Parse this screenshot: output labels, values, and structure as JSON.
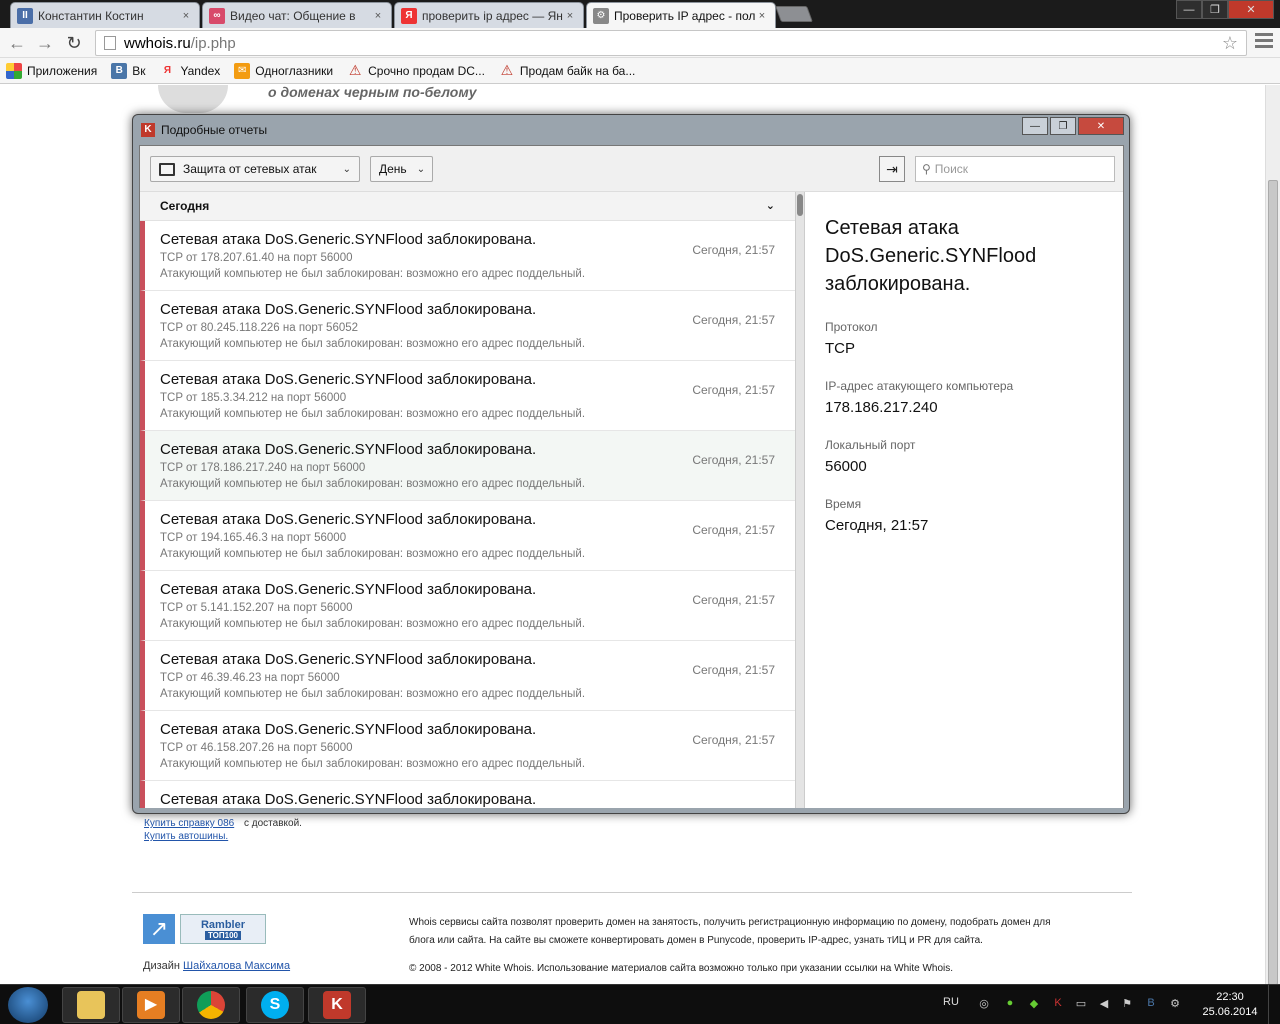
{
  "browser": {
    "tabs": [
      {
        "title": "Константин Костин",
        "favicon_color": "#4a6ea8",
        "favicon_glyph": "II"
      },
      {
        "title": "Видео чат: Общение в",
        "favicon_color": "#d84a6a",
        "favicon_glyph": "∞"
      },
      {
        "title": "проверить ip адрес — Ян",
        "favicon_color": "#e33",
        "favicon_glyph": "Я"
      },
      {
        "title": "Проверить IP адрес - пол",
        "favicon_color": "#888",
        "favicon_glyph": "⚙"
      }
    ],
    "tab_close": "×",
    "window_controls": {
      "minimize": "—",
      "maximize": "❐",
      "close": "✕"
    },
    "nav": {
      "back": "←",
      "forward": "→",
      "reload": "↻"
    },
    "url_host": "wwhois.ru",
    "url_path": "/ip.php",
    "star": "☆",
    "bookmarks": [
      {
        "label": "Приложения",
        "icon": "apps-icon",
        "color": "#e44"
      },
      {
        "label": "Вк",
        "icon": "vk-icon",
        "color": "#4a76a8",
        "glyph": "В"
      },
      {
        "label": "Yandex",
        "icon": "yandex-icon",
        "color": "#fff",
        "glyph": "Я"
      },
      {
        "label": "Одноглазники",
        "icon": "mail-icon",
        "color": "#f39c12",
        "glyph": "✉"
      },
      {
        "label": "Срочно продам DC...",
        "icon": "warning-icon",
        "color": "#fff",
        "glyph": "⚠"
      },
      {
        "label": "Продам байк на ба...",
        "icon": "warning-icon",
        "color": "#fff",
        "glyph": "⚠"
      }
    ]
  },
  "page": {
    "tagline": "о доменах черным по-белому",
    "link_buy_086": "Купить справку 086",
    "text_delivery": "с доставкой.",
    "link_tires": "Купить автошины.",
    "rambler_title": "Rambler",
    "rambler_sub": "ТОП100",
    "design_prefix": "Дизайн",
    "design_link": "Шайхалова Максима",
    "footer_line1": "Whois сервисы сайта позволят проверить домен на занятость, получить регистрационную информацию по домену, подобрать домен для",
    "footer_line2": "блога или сайта. На сайте вы сможете конвертировать домен в Punycode, проверить IP-адрес, узнать тИЦ и PR для сайта.",
    "footer_copyright": "© 2008 - 2012 White Whois. Использование материалов сайта возможно только при указании ссылки на White Whois."
  },
  "kaspersky": {
    "window_title": "Подробные отчеты",
    "filter_category": "Защита от сетевых атак",
    "filter_period": "День",
    "search_placeholder": "Поиск",
    "group_label": "Сегодня",
    "rows": [
      {
        "title": "Сетевая атака DoS.Generic.SYNFlood заблокирована.",
        "sub": "TCP от 178.207.61.40 на порт 56000",
        "note": "Атакующий компьютер не был заблокирован: возможно его адрес поддельный.",
        "time": "Сегодня, 21:57",
        "selected": false
      },
      {
        "title": "Сетевая атака DoS.Generic.SYNFlood заблокирована.",
        "sub": "TCP от 80.245.118.226 на порт 56052",
        "note": "Атакующий компьютер не был заблокирован: возможно его адрес поддельный.",
        "time": "Сегодня, 21:57",
        "selected": false
      },
      {
        "title": "Сетевая атака DoS.Generic.SYNFlood заблокирована.",
        "sub": "TCP от 185.3.34.212 на порт 56000",
        "note": "Атакующий компьютер не был заблокирован: возможно его адрес поддельный.",
        "time": "Сегодня, 21:57",
        "selected": false
      },
      {
        "title": "Сетевая атака DoS.Generic.SYNFlood заблокирована.",
        "sub": "TCP от 178.186.217.240 на порт 56000",
        "note": "Атакующий компьютер не был заблокирован: возможно его адрес поддельный.",
        "time": "Сегодня, 21:57",
        "selected": true
      },
      {
        "title": "Сетевая атака DoS.Generic.SYNFlood заблокирована.",
        "sub": "TCP от 194.165.46.3 на порт 56000",
        "note": "Атакующий компьютер не был заблокирован: возможно его адрес поддельный.",
        "time": "Сегодня, 21:57",
        "selected": false
      },
      {
        "title": "Сетевая атака DoS.Generic.SYNFlood заблокирована.",
        "sub": "TCP от 5.141.152.207 на порт 56000",
        "note": "Атакующий компьютер не был заблокирован: возможно его адрес поддельный.",
        "time": "Сегодня, 21:57",
        "selected": false
      },
      {
        "title": "Сетевая атака DoS.Generic.SYNFlood заблокирована.",
        "sub": "TCP от 46.39.46.23 на порт 56000",
        "note": "Атакующий компьютер не был заблокирован: возможно его адрес поддельный.",
        "time": "Сегодня, 21:57",
        "selected": false
      },
      {
        "title": "Сетевая атака DoS.Generic.SYNFlood заблокирована.",
        "sub": "TCP от 46.158.207.26 на порт 56000",
        "note": "Атакующий компьютер не был заблокирован: возможно его адрес поддельный.",
        "time": "Сегодня, 21:57",
        "selected": false
      },
      {
        "title": "Сетевая атака DoS.Generic.SYNFlood заблокирована.",
        "sub": "",
        "note": "",
        "time": "",
        "selected": false
      }
    ],
    "detail": {
      "title": "Сетевая атака DoS.Generic.SYNFlood заблокирована.",
      "protocol_label": "Протокол",
      "protocol_value": "TCP",
      "ip_label": "IP-адрес атакующего компьютера",
      "ip_value": "178.186.217.240",
      "port_label": "Локальный порт",
      "port_value": "56000",
      "time_label": "Время",
      "time_value": "Сегодня, 21:57"
    }
  },
  "taskbar": {
    "language": "RU",
    "time": "22:30",
    "date": "25.06.2014"
  }
}
